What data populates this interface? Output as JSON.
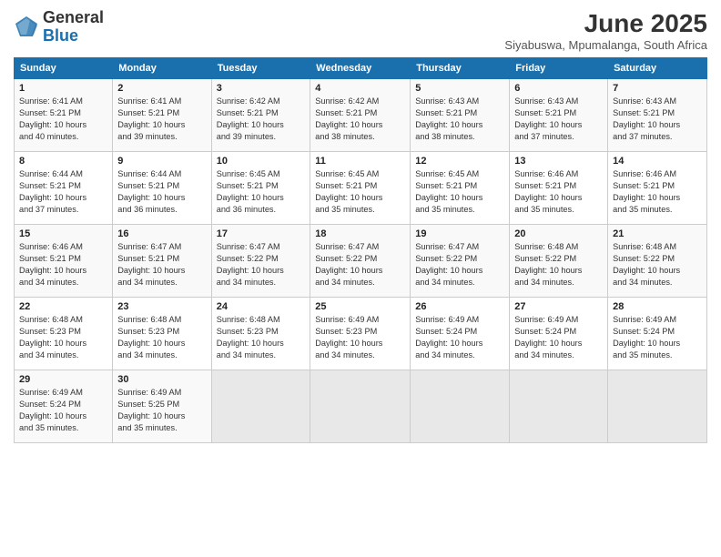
{
  "logo": {
    "general": "General",
    "blue": "Blue"
  },
  "title": "June 2025",
  "subtitle": "Siyabuswa, Mpumalanga, South Africa",
  "headers": [
    "Sunday",
    "Monday",
    "Tuesday",
    "Wednesday",
    "Thursday",
    "Friday",
    "Saturday"
  ],
  "weeks": [
    [
      {
        "day": "1",
        "info": "Sunrise: 6:41 AM\nSunset: 5:21 PM\nDaylight: 10 hours\nand 40 minutes."
      },
      {
        "day": "2",
        "info": "Sunrise: 6:41 AM\nSunset: 5:21 PM\nDaylight: 10 hours\nand 39 minutes."
      },
      {
        "day": "3",
        "info": "Sunrise: 6:42 AM\nSunset: 5:21 PM\nDaylight: 10 hours\nand 39 minutes."
      },
      {
        "day": "4",
        "info": "Sunrise: 6:42 AM\nSunset: 5:21 PM\nDaylight: 10 hours\nand 38 minutes."
      },
      {
        "day": "5",
        "info": "Sunrise: 6:43 AM\nSunset: 5:21 PM\nDaylight: 10 hours\nand 38 minutes."
      },
      {
        "day": "6",
        "info": "Sunrise: 6:43 AM\nSunset: 5:21 PM\nDaylight: 10 hours\nand 37 minutes."
      },
      {
        "day": "7",
        "info": "Sunrise: 6:43 AM\nSunset: 5:21 PM\nDaylight: 10 hours\nand 37 minutes."
      }
    ],
    [
      {
        "day": "8",
        "info": "Sunrise: 6:44 AM\nSunset: 5:21 PM\nDaylight: 10 hours\nand 37 minutes."
      },
      {
        "day": "9",
        "info": "Sunrise: 6:44 AM\nSunset: 5:21 PM\nDaylight: 10 hours\nand 36 minutes."
      },
      {
        "day": "10",
        "info": "Sunrise: 6:45 AM\nSunset: 5:21 PM\nDaylight: 10 hours\nand 36 minutes."
      },
      {
        "day": "11",
        "info": "Sunrise: 6:45 AM\nSunset: 5:21 PM\nDaylight: 10 hours\nand 35 minutes."
      },
      {
        "day": "12",
        "info": "Sunrise: 6:45 AM\nSunset: 5:21 PM\nDaylight: 10 hours\nand 35 minutes."
      },
      {
        "day": "13",
        "info": "Sunrise: 6:46 AM\nSunset: 5:21 PM\nDaylight: 10 hours\nand 35 minutes."
      },
      {
        "day": "14",
        "info": "Sunrise: 6:46 AM\nSunset: 5:21 PM\nDaylight: 10 hours\nand 35 minutes."
      }
    ],
    [
      {
        "day": "15",
        "info": "Sunrise: 6:46 AM\nSunset: 5:21 PM\nDaylight: 10 hours\nand 34 minutes."
      },
      {
        "day": "16",
        "info": "Sunrise: 6:47 AM\nSunset: 5:21 PM\nDaylight: 10 hours\nand 34 minutes."
      },
      {
        "day": "17",
        "info": "Sunrise: 6:47 AM\nSunset: 5:22 PM\nDaylight: 10 hours\nand 34 minutes."
      },
      {
        "day": "18",
        "info": "Sunrise: 6:47 AM\nSunset: 5:22 PM\nDaylight: 10 hours\nand 34 minutes."
      },
      {
        "day": "19",
        "info": "Sunrise: 6:47 AM\nSunset: 5:22 PM\nDaylight: 10 hours\nand 34 minutes."
      },
      {
        "day": "20",
        "info": "Sunrise: 6:48 AM\nSunset: 5:22 PM\nDaylight: 10 hours\nand 34 minutes."
      },
      {
        "day": "21",
        "info": "Sunrise: 6:48 AM\nSunset: 5:22 PM\nDaylight: 10 hours\nand 34 minutes."
      }
    ],
    [
      {
        "day": "22",
        "info": "Sunrise: 6:48 AM\nSunset: 5:23 PM\nDaylight: 10 hours\nand 34 minutes."
      },
      {
        "day": "23",
        "info": "Sunrise: 6:48 AM\nSunset: 5:23 PM\nDaylight: 10 hours\nand 34 minutes."
      },
      {
        "day": "24",
        "info": "Sunrise: 6:48 AM\nSunset: 5:23 PM\nDaylight: 10 hours\nand 34 minutes."
      },
      {
        "day": "25",
        "info": "Sunrise: 6:49 AM\nSunset: 5:23 PM\nDaylight: 10 hours\nand 34 minutes."
      },
      {
        "day": "26",
        "info": "Sunrise: 6:49 AM\nSunset: 5:24 PM\nDaylight: 10 hours\nand 34 minutes."
      },
      {
        "day": "27",
        "info": "Sunrise: 6:49 AM\nSunset: 5:24 PM\nDaylight: 10 hours\nand 34 minutes."
      },
      {
        "day": "28",
        "info": "Sunrise: 6:49 AM\nSunset: 5:24 PM\nDaylight: 10 hours\nand 35 minutes."
      }
    ],
    [
      {
        "day": "29",
        "info": "Sunrise: 6:49 AM\nSunset: 5:24 PM\nDaylight: 10 hours\nand 35 minutes."
      },
      {
        "day": "30",
        "info": "Sunrise: 6:49 AM\nSunset: 5:25 PM\nDaylight: 10 hours\nand 35 minutes."
      },
      {
        "day": "",
        "info": ""
      },
      {
        "day": "",
        "info": ""
      },
      {
        "day": "",
        "info": ""
      },
      {
        "day": "",
        "info": ""
      },
      {
        "day": "",
        "info": ""
      }
    ]
  ]
}
